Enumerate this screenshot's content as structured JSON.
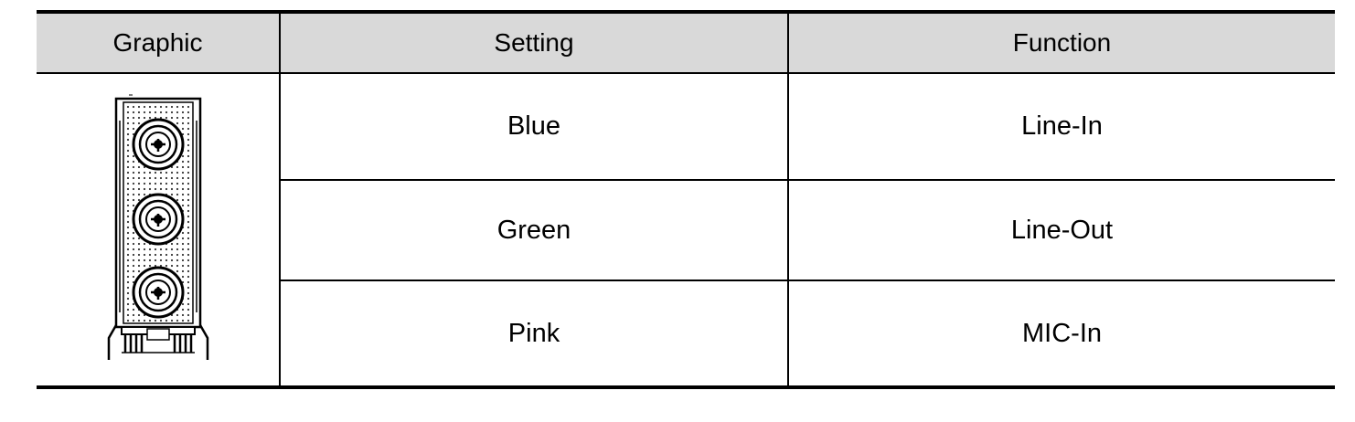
{
  "table": {
    "headers": [
      "Graphic",
      "Setting",
      "Function"
    ],
    "graphic": {
      "icon": "audio-jack-panel-icon",
      "jack_count": 3
    },
    "rows": [
      {
        "setting": "Blue",
        "function": "Line-In"
      },
      {
        "setting": "Green",
        "function": "Line-Out"
      },
      {
        "setting": "Pink",
        "function": "MIC-In"
      }
    ]
  }
}
